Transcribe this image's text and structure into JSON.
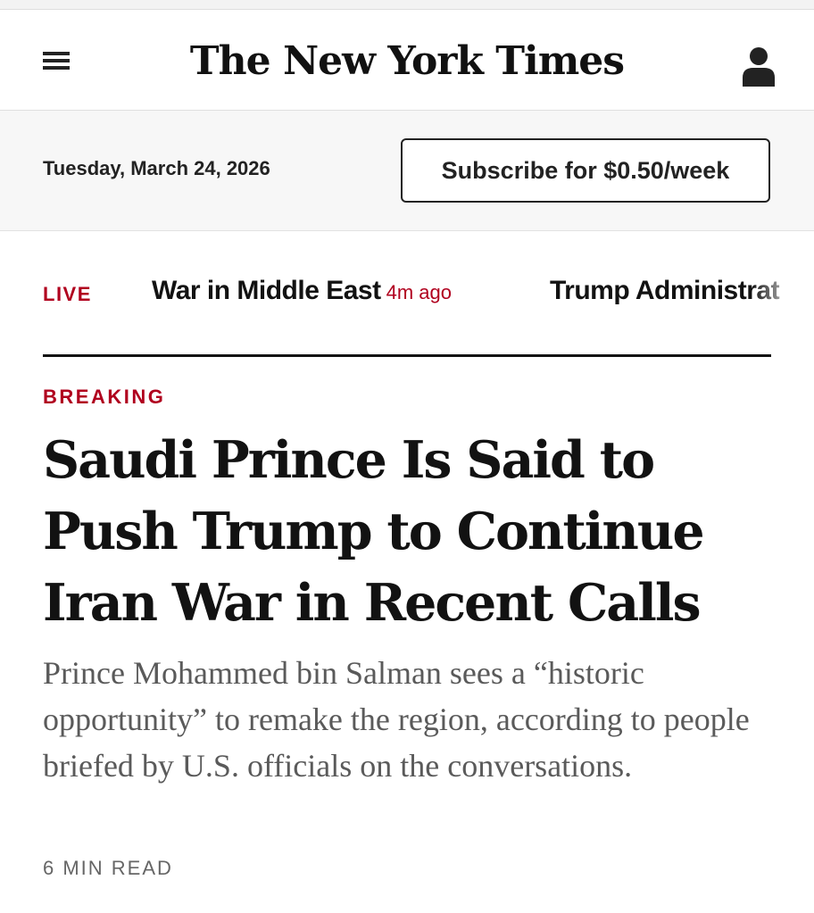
{
  "header": {
    "masthead": "The New York Times",
    "menu_icon": "hamburger-menu-icon",
    "account_icon": "user-account-icon"
  },
  "datebar": {
    "date": "Tuesday, March 24, 2026",
    "subscribe_label": "Subscribe for $0.50/week"
  },
  "ticker": {
    "live_label": "LIVE",
    "items": [
      {
        "title": "War in Middle East",
        "time": "4m ago"
      },
      {
        "title": "Trump Administrat"
      }
    ]
  },
  "article": {
    "kicker": "BREAKING",
    "headline": "Saudi Prince Is Said to Push Trump to Continue Iran War in Recent Calls",
    "summary": "Prince Mohammed bin Salman sees a “historic opportunity” to remake the region, according to people briefed by U.S. officials on the conversations.",
    "read_time": "6 MIN READ"
  },
  "colors": {
    "accent_red": "#b0001e",
    "text": "#121212",
    "summary_gray": "#5a5a5a",
    "datebar_bg": "#f7f7f7"
  }
}
